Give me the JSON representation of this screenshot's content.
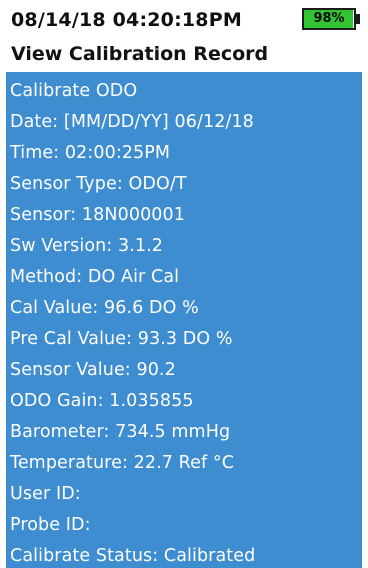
{
  "status_bar": {
    "datetime": "08/14/18 04:20:18PM",
    "battery": {
      "text": "98%",
      "level_percent": 98,
      "color": "#33c433"
    }
  },
  "screen": {
    "title": "View Calibration Record"
  },
  "record": {
    "panel_color": "#3e8dd0",
    "lines": [
      "Calibrate ODO",
      "Date: [MM/DD/YY] 06/12/18",
      "Time: 02:00:25PM",
      "Sensor Type: ODO/T",
      "Sensor: 18N000001",
      "Sw Version: 3.1.2",
      "Method: DO Air Cal",
      "Cal Value: 96.6 DO %",
      "Pre Cal Value: 93.3 DO %",
      "Sensor Value:  90.2",
      "ODO Gain: 1.035855",
      "Barometer: 734.5 mmHg",
      "Temperature: 22.7 Ref °C",
      "User ID:",
      "Probe ID:",
      "Calibrate Status: Calibrated"
    ]
  }
}
